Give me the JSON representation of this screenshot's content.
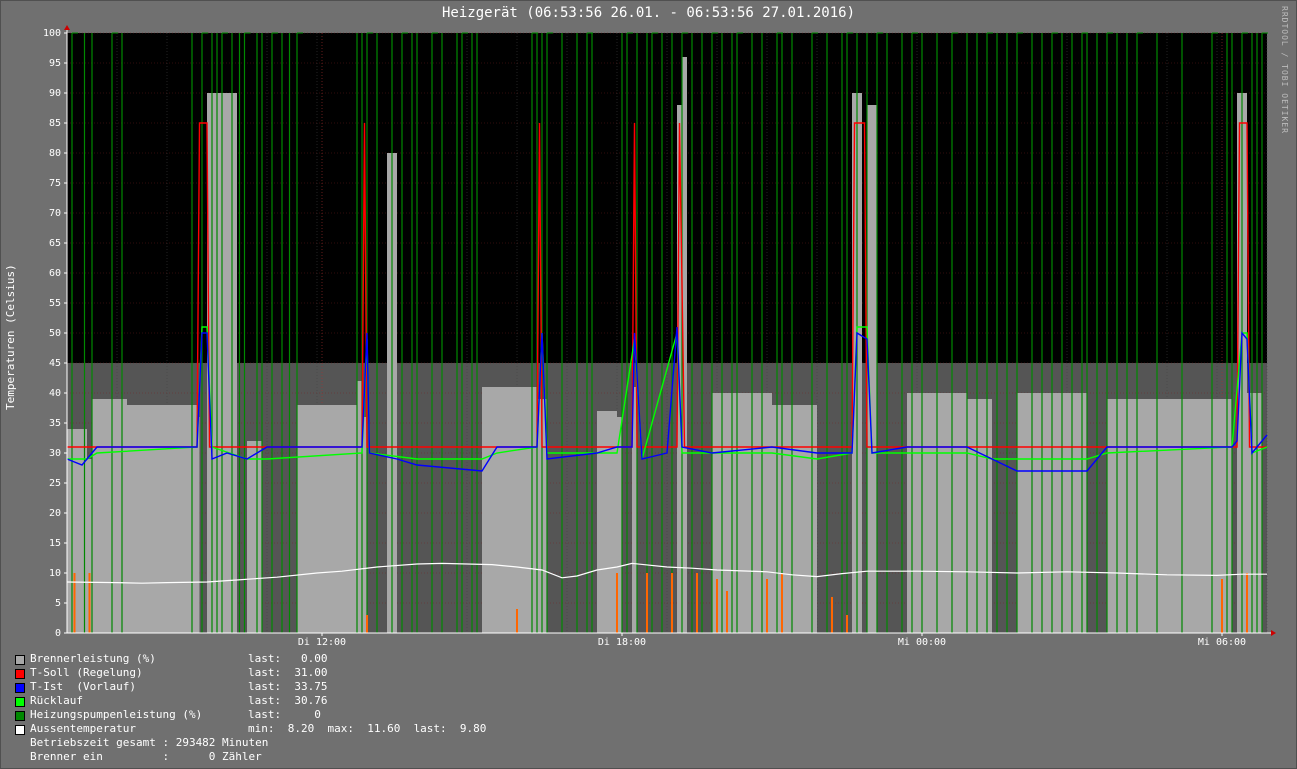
{
  "chart_data": {
    "type": "area",
    "title": "Heizgerät (06:53:56 26.01. - 06:53:56 27.01.2016)",
    "watermark": "RRDTOOL / TOBI OETIKER",
    "ylabel": "Temperaturen (Celsius)",
    "ylim": [
      0,
      100
    ],
    "yticks": [
      "0",
      "5",
      "10",
      "15",
      "20",
      "25",
      "30",
      "35",
      "40",
      "45",
      "50",
      "55",
      "60",
      "65",
      "70",
      "75",
      "80",
      "85",
      "90",
      "95",
      "100"
    ],
    "xrange_hours": [
      0,
      24
    ],
    "xticks": [
      {
        "t": 5.1,
        "label": "Di 12:00"
      },
      {
        "t": 11.1,
        "label": "Di 18:00"
      },
      {
        "t": 17.1,
        "label": "Mi 00:00"
      },
      {
        "t": 23.1,
        "label": "Mi 06:00"
      }
    ],
    "colors": {
      "background": "#707070",
      "plot": "#000000",
      "grid": "#3a3a3a",
      "brenner": "#a8a8a8",
      "brenner_shadow": "#555555",
      "tsoll": "#ff0000",
      "tist": "#0000ff",
      "ruecklauf": "#00ff00",
      "pumpe": "#008800",
      "aussen": "#ffffff",
      "orange": "#ff6600"
    },
    "series": [
      {
        "name": "Brennerleistung (%)",
        "key": "brenner",
        "color": "#a8a8a8",
        "segments": [
          [
            0,
            0.4,
            34
          ],
          [
            0.4,
            0.5,
            29
          ],
          [
            0.5,
            1.2,
            39
          ],
          [
            1.2,
            2.6,
            38
          ],
          [
            2.6,
            2.65,
            36
          ],
          [
            2.8,
            3.4,
            90
          ],
          [
            3.6,
            3.9,
            32
          ],
          [
            4.6,
            5.8,
            38
          ],
          [
            5.8,
            5.9,
            42
          ],
          [
            5.9,
            6.0,
            36
          ],
          [
            6.4,
            6.6,
            80
          ],
          [
            8.3,
            9.4,
            41
          ],
          [
            9.4,
            9.6,
            39
          ],
          [
            10.6,
            11.0,
            37
          ],
          [
            11.0,
            11.1,
            36
          ],
          [
            11.3,
            11.4,
            41
          ],
          [
            12.2,
            12.3,
            88
          ],
          [
            12.3,
            12.4,
            96
          ],
          [
            12.9,
            14.1,
            40
          ],
          [
            14.1,
            15.0,
            38
          ],
          [
            15.7,
            15.9,
            90
          ],
          [
            16.0,
            16.2,
            88
          ],
          [
            16.8,
            18.0,
            40
          ],
          [
            18.0,
            18.5,
            39
          ],
          [
            19.0,
            20.4,
            40
          ],
          [
            20.8,
            23.3,
            39
          ],
          [
            23.4,
            23.6,
            90
          ],
          [
            23.6,
            23.9,
            40
          ]
        ]
      },
      {
        "name": "T-Soll (Regelung)",
        "key": "tsoll",
        "color": "#ff0000",
        "points": [
          [
            0,
            31
          ],
          [
            2.6,
            31
          ],
          [
            2.65,
            85
          ],
          [
            2.8,
            85
          ],
          [
            2.85,
            31
          ],
          [
            5.9,
            31
          ],
          [
            5.95,
            85
          ],
          [
            6.0,
            31
          ],
          [
            9.4,
            31
          ],
          [
            9.45,
            85
          ],
          [
            9.5,
            31
          ],
          [
            11.3,
            31
          ],
          [
            11.35,
            85
          ],
          [
            11.4,
            31
          ],
          [
            12.2,
            31
          ],
          [
            12.25,
            85
          ],
          [
            12.35,
            31
          ],
          [
            15.7,
            31
          ],
          [
            15.75,
            85
          ],
          [
            15.95,
            85
          ],
          [
            16.0,
            31
          ],
          [
            23.4,
            31
          ],
          [
            23.45,
            85
          ],
          [
            23.6,
            85
          ],
          [
            23.65,
            31
          ],
          [
            24,
            31
          ]
        ],
        "last": "31.00"
      },
      {
        "name": "T-Ist  (Vorlauf)",
        "key": "tist",
        "color": "#0000ff",
        "points": [
          [
            0,
            29
          ],
          [
            0.3,
            28
          ],
          [
            0.6,
            31
          ],
          [
            2.6,
            31
          ],
          [
            2.7,
            50
          ],
          [
            2.8,
            50
          ],
          [
            2.9,
            29
          ],
          [
            3.2,
            30
          ],
          [
            3.6,
            29
          ],
          [
            4.0,
            31
          ],
          [
            5.9,
            31
          ],
          [
            6.0,
            50
          ],
          [
            6.05,
            30
          ],
          [
            6.6,
            29
          ],
          [
            7.0,
            28
          ],
          [
            8.3,
            27
          ],
          [
            8.6,
            31
          ],
          [
            9.4,
            31
          ],
          [
            9.5,
            50
          ],
          [
            9.6,
            29
          ],
          [
            10.6,
            30
          ],
          [
            11.0,
            31
          ],
          [
            11.3,
            31
          ],
          [
            11.35,
            50
          ],
          [
            11.5,
            29
          ],
          [
            12.0,
            30
          ],
          [
            12.2,
            51
          ],
          [
            12.3,
            31
          ],
          [
            12.9,
            30
          ],
          [
            14.1,
            31
          ],
          [
            15.0,
            30
          ],
          [
            15.7,
            30
          ],
          [
            15.8,
            50
          ],
          [
            16.0,
            49
          ],
          [
            16.1,
            30
          ],
          [
            16.8,
            31
          ],
          [
            18.0,
            31
          ],
          [
            18.5,
            29
          ],
          [
            19.0,
            27
          ],
          [
            20.4,
            27
          ],
          [
            20.8,
            31
          ],
          [
            23.3,
            31
          ],
          [
            23.4,
            32
          ],
          [
            23.5,
            50
          ],
          [
            23.6,
            49
          ],
          [
            23.7,
            30
          ],
          [
            24,
            33
          ]
        ],
        "last": "33.75"
      },
      {
        "name": "Rücklauf",
        "key": "ruecklauf",
        "color": "#00ff00",
        "points": [
          [
            0,
            29
          ],
          [
            0.4,
            29
          ],
          [
            0.6,
            30
          ],
          [
            2.6,
            31
          ],
          [
            2.7,
            51
          ],
          [
            2.8,
            51
          ],
          [
            2.9,
            31
          ],
          [
            3.6,
            29
          ],
          [
            4.0,
            29
          ],
          [
            5.9,
            30
          ],
          [
            6.0,
            49
          ],
          [
            6.05,
            30
          ],
          [
            7.0,
            29
          ],
          [
            8.3,
            29
          ],
          [
            8.6,
            30
          ],
          [
            9.4,
            31
          ],
          [
            9.5,
            50
          ],
          [
            9.6,
            30
          ],
          [
            10.6,
            30
          ],
          [
            11.0,
            30
          ],
          [
            11.35,
            49
          ],
          [
            11.5,
            29
          ],
          [
            12.2,
            50
          ],
          [
            12.3,
            30
          ],
          [
            12.9,
            30
          ],
          [
            14.1,
            30
          ],
          [
            15.0,
            29
          ],
          [
            15.7,
            30
          ],
          [
            15.8,
            51
          ],
          [
            16.0,
            51
          ],
          [
            16.1,
            30
          ],
          [
            16.8,
            30
          ],
          [
            18.0,
            30
          ],
          [
            18.5,
            29
          ],
          [
            19.0,
            29
          ],
          [
            20.4,
            29
          ],
          [
            20.8,
            30
          ],
          [
            23.3,
            31
          ],
          [
            23.5,
            50
          ],
          [
            23.6,
            50
          ],
          [
            23.7,
            30
          ],
          [
            24,
            31
          ]
        ],
        "last": "30.76"
      },
      {
        "name": "Heizungspumpenleistung (%)",
        "key": "pumpe",
        "color": "#008800",
        "spikes": [
          0.1,
          0.35,
          0.5,
          0.9,
          1.1,
          2.5,
          2.7,
          2.9,
          3.0,
          3.1,
          3.3,
          3.45,
          3.55,
          3.8,
          3.9,
          4.1,
          4.3,
          4.45,
          4.6,
          5.8,
          5.9,
          6.0,
          6.2,
          6.5,
          6.7,
          6.9,
          7.0,
          7.3,
          7.5,
          7.8,
          7.9,
          8.1,
          8.2,
          9.3,
          9.4,
          9.5,
          9.6,
          9.9,
          10.2,
          10.4,
          10.5,
          11.1,
          11.2,
          11.4,
          11.6,
          11.7,
          11.9,
          12.1,
          12.3,
          12.5,
          12.7,
          12.9,
          13.1,
          13.3,
          13.4,
          13.7,
          13.9,
          14.2,
          14.3,
          14.5,
          14.9,
          15.2,
          15.5,
          15.6,
          15.8,
          16.0,
          16.2,
          16.4,
          16.7,
          16.9,
          17.1,
          17.4,
          17.7,
          18.0,
          18.2,
          18.4,
          18.6,
          18.8,
          19.0,
          19.3,
          19.5,
          19.7,
          19.9,
          20.1,
          20.3,
          20.4,
          20.6,
          20.8,
          21.0,
          21.2,
          21.4,
          21.8,
          22.3,
          22.9,
          23.2,
          23.3,
          23.5,
          23.7,
          23.8,
          23.9
        ],
        "last": "0"
      },
      {
        "name": "Aussentemperatur",
        "key": "aussen",
        "color": "#ffffff",
        "points": [
          [
            0,
            8.5
          ],
          [
            1.0,
            8.4
          ],
          [
            1.5,
            8.3
          ],
          [
            2.0,
            8.4
          ],
          [
            2.8,
            8.5
          ],
          [
            3.5,
            8.9
          ],
          [
            4.2,
            9.3
          ],
          [
            5.0,
            10.0
          ],
          [
            5.5,
            10.3
          ],
          [
            6.2,
            11.0
          ],
          [
            7.0,
            11.5
          ],
          [
            7.5,
            11.6
          ],
          [
            8.5,
            11.4
          ],
          [
            9.0,
            11.0
          ],
          [
            9.5,
            10.5
          ],
          [
            9.9,
            9.2
          ],
          [
            10.2,
            9.5
          ],
          [
            10.6,
            10.5
          ],
          [
            11.0,
            11.0
          ],
          [
            11.3,
            11.6
          ],
          [
            12.0,
            11.0
          ],
          [
            12.5,
            10.8
          ],
          [
            13.0,
            10.5
          ],
          [
            14.0,
            10.2
          ],
          [
            14.5,
            9.7
          ],
          [
            15.0,
            9.4
          ],
          [
            15.5,
            9.9
          ],
          [
            16.0,
            10.3
          ],
          [
            17.0,
            10.3
          ],
          [
            18.0,
            10.2
          ],
          [
            19.0,
            10.0
          ],
          [
            20.0,
            10.2
          ],
          [
            21.0,
            10.0
          ],
          [
            22.0,
            9.7
          ],
          [
            23.0,
            9.6
          ],
          [
            23.5,
            9.8
          ],
          [
            24,
            9.8
          ]
        ]
      },
      {
        "name": "Orange",
        "key": "orange",
        "color": "#ff6600",
        "spikes": [
          [
            0.15,
            10
          ],
          [
            0.45,
            10
          ],
          [
            6.0,
            3
          ],
          [
            9.0,
            4
          ],
          [
            11.0,
            10
          ],
          [
            11.6,
            10
          ],
          [
            12.1,
            10
          ],
          [
            12.6,
            10
          ],
          [
            13.0,
            9
          ],
          [
            13.2,
            7
          ],
          [
            14.0,
            9
          ],
          [
            14.3,
            10
          ],
          [
            15.3,
            6
          ],
          [
            15.6,
            3
          ],
          [
            23.1,
            9
          ],
          [
            23.6,
            10
          ]
        ]
      }
    ],
    "legend_rows": [
      {
        "name": "Brennerleistung (%)",
        "color": "#a8a8a8",
        "stats": "last:   0.00"
      },
      {
        "name": "T-Soll (Regelung)",
        "color": "#ff0000",
        "stats": "last:  31.00"
      },
      {
        "name": "T-Ist  (Vorlauf)",
        "color": "#0000ff",
        "stats": "last:  33.75"
      },
      {
        "name": "Rücklauf",
        "color": "#00ff00",
        "stats": "last:  30.76"
      },
      {
        "name": "Heizungspumpenleistung (%)",
        "color": "#008800",
        "stats": "last:     0"
      },
      {
        "name": "Aussentemperatur",
        "color": "#ffffff",
        "stats": "min:  8.20  max:  11.60  last:  9.80"
      }
    ],
    "footer": [
      "Betriebszeit gesamt : 293482 Minuten",
      "Brenner ein         :      0 Zähler"
    ]
  }
}
